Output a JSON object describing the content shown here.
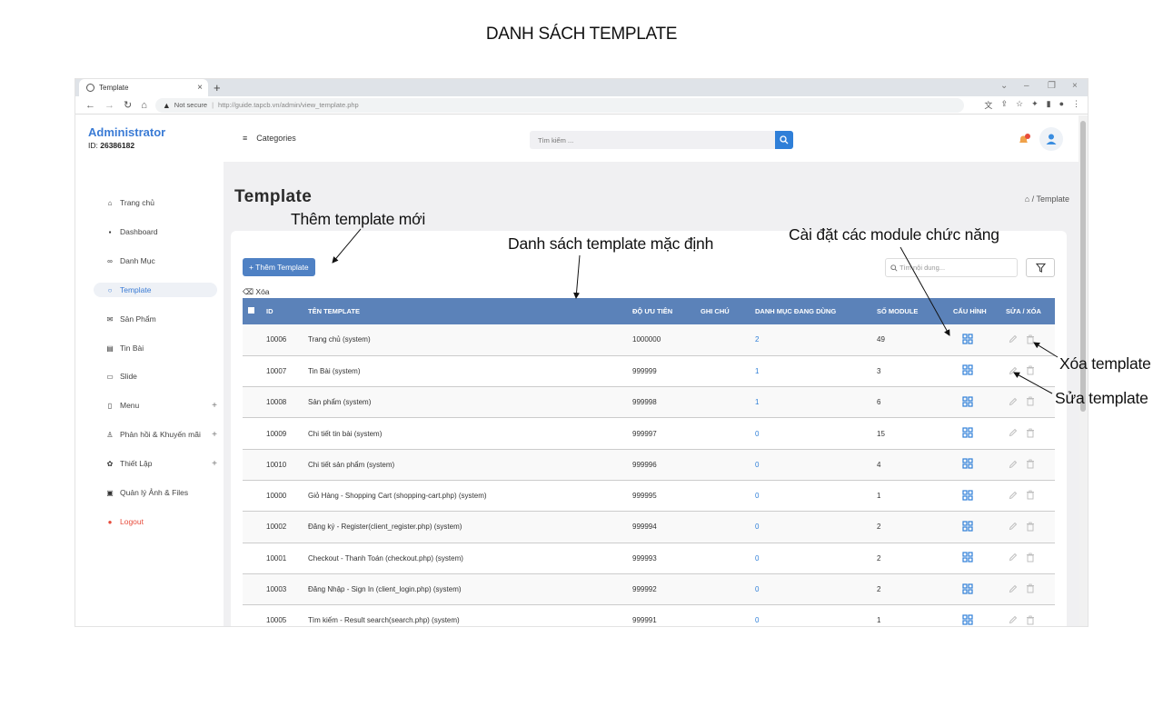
{
  "heading": "DANH SÁCH TEMPLATE",
  "browser": {
    "tab_title": "Template",
    "not_secure": "Not secure",
    "url": "http://guide.tapcb.vn/admin/view_template.php"
  },
  "topbar": {
    "brand": "Administrator",
    "id_label": "ID:",
    "id_value": "26386182",
    "categories": "Categories",
    "search_placeholder": "Tìm kiếm ..."
  },
  "sidebar": {
    "items": [
      {
        "label": "Trang chủ",
        "icon": "home-icon"
      },
      {
        "label": "Dashboard",
        "icon": "dashboard-icon"
      },
      {
        "label": "Danh Mục",
        "icon": "link-icon"
      },
      {
        "label": "Template",
        "icon": "circle-icon"
      },
      {
        "label": "Sản Phẩm",
        "icon": "mail-icon"
      },
      {
        "label": "Tin Bài",
        "icon": "news-icon"
      },
      {
        "label": "Slide",
        "icon": "slide-icon"
      },
      {
        "label": "Menu",
        "icon": "menu-icon"
      },
      {
        "label": "Phản hồi & Khuyến mãi",
        "icon": "user-icon"
      },
      {
        "label": "Thiết Lập",
        "icon": "gear-icon"
      },
      {
        "label": "Quản lý Ảnh & Files",
        "icon": "image-icon"
      },
      {
        "label": "Logout",
        "icon": "logout-icon"
      }
    ],
    "active_color": "#3a7bd5"
  },
  "main": {
    "title": "Template",
    "breadcrumb": "/ Template",
    "add_button": "+ Thêm Template",
    "delete_link": "Xóa",
    "filter_placeholder": "Tìm nội dung..."
  },
  "table": {
    "columns": [
      "ID",
      "TÊN TEMPLATE",
      "ĐỘ ƯU TIÊN",
      "GHI CHÚ",
      "DANH MỤC ĐANG DÙNG",
      "SỐ MODULE",
      "CẤU HÌNH",
      "SỬA / XÓA"
    ],
    "rows": [
      {
        "id": "10006",
        "name": "Trang chủ (system)",
        "priority": "1000000",
        "note": "",
        "cat": "2",
        "modules": "49"
      },
      {
        "id": "10007",
        "name": "Tin Bài (system)",
        "priority": "999999",
        "note": "",
        "cat": "1",
        "modules": "3"
      },
      {
        "id": "10008",
        "name": "Sản phẩm (system)",
        "priority": "999998",
        "note": "",
        "cat": "1",
        "modules": "6"
      },
      {
        "id": "10009",
        "name": "Chi tiết tin bài (system)",
        "priority": "999997",
        "note": "",
        "cat": "0",
        "modules": "15"
      },
      {
        "id": "10010",
        "name": "Chi tiết sản phẩm (system)",
        "priority": "999996",
        "note": "",
        "cat": "0",
        "modules": "4"
      },
      {
        "id": "10000",
        "name": "Giỏ Hàng - Shopping Cart (shopping-cart.php) (system)",
        "priority": "999995",
        "note": "",
        "cat": "0",
        "modules": "1"
      },
      {
        "id": "10002",
        "name": "Đăng ký - Register(client_register.php) (system)",
        "priority": "999994",
        "note": "",
        "cat": "0",
        "modules": "2"
      },
      {
        "id": "10001",
        "name": "Checkout - Thanh Toán (checkout.php) (system)",
        "priority": "999993",
        "note": "",
        "cat": "0",
        "modules": "2"
      },
      {
        "id": "10003",
        "name": "Đăng Nhập - Sign In (client_login.php) (system)",
        "priority": "999992",
        "note": "",
        "cat": "0",
        "modules": "2"
      },
      {
        "id": "10005",
        "name": "Tìm kiếm - Result search(search.php) (system)",
        "priority": "999991",
        "note": "",
        "cat": "0",
        "modules": "1"
      }
    ],
    "header_color": "#5b82b9"
  },
  "annotations": {
    "add_new": "Thêm template mới",
    "default_list": "Danh sách template mặc định",
    "module_settings": "Cài đặt các module chức năng",
    "delete_template": "Xóa template",
    "edit_template": "Sửa template"
  }
}
